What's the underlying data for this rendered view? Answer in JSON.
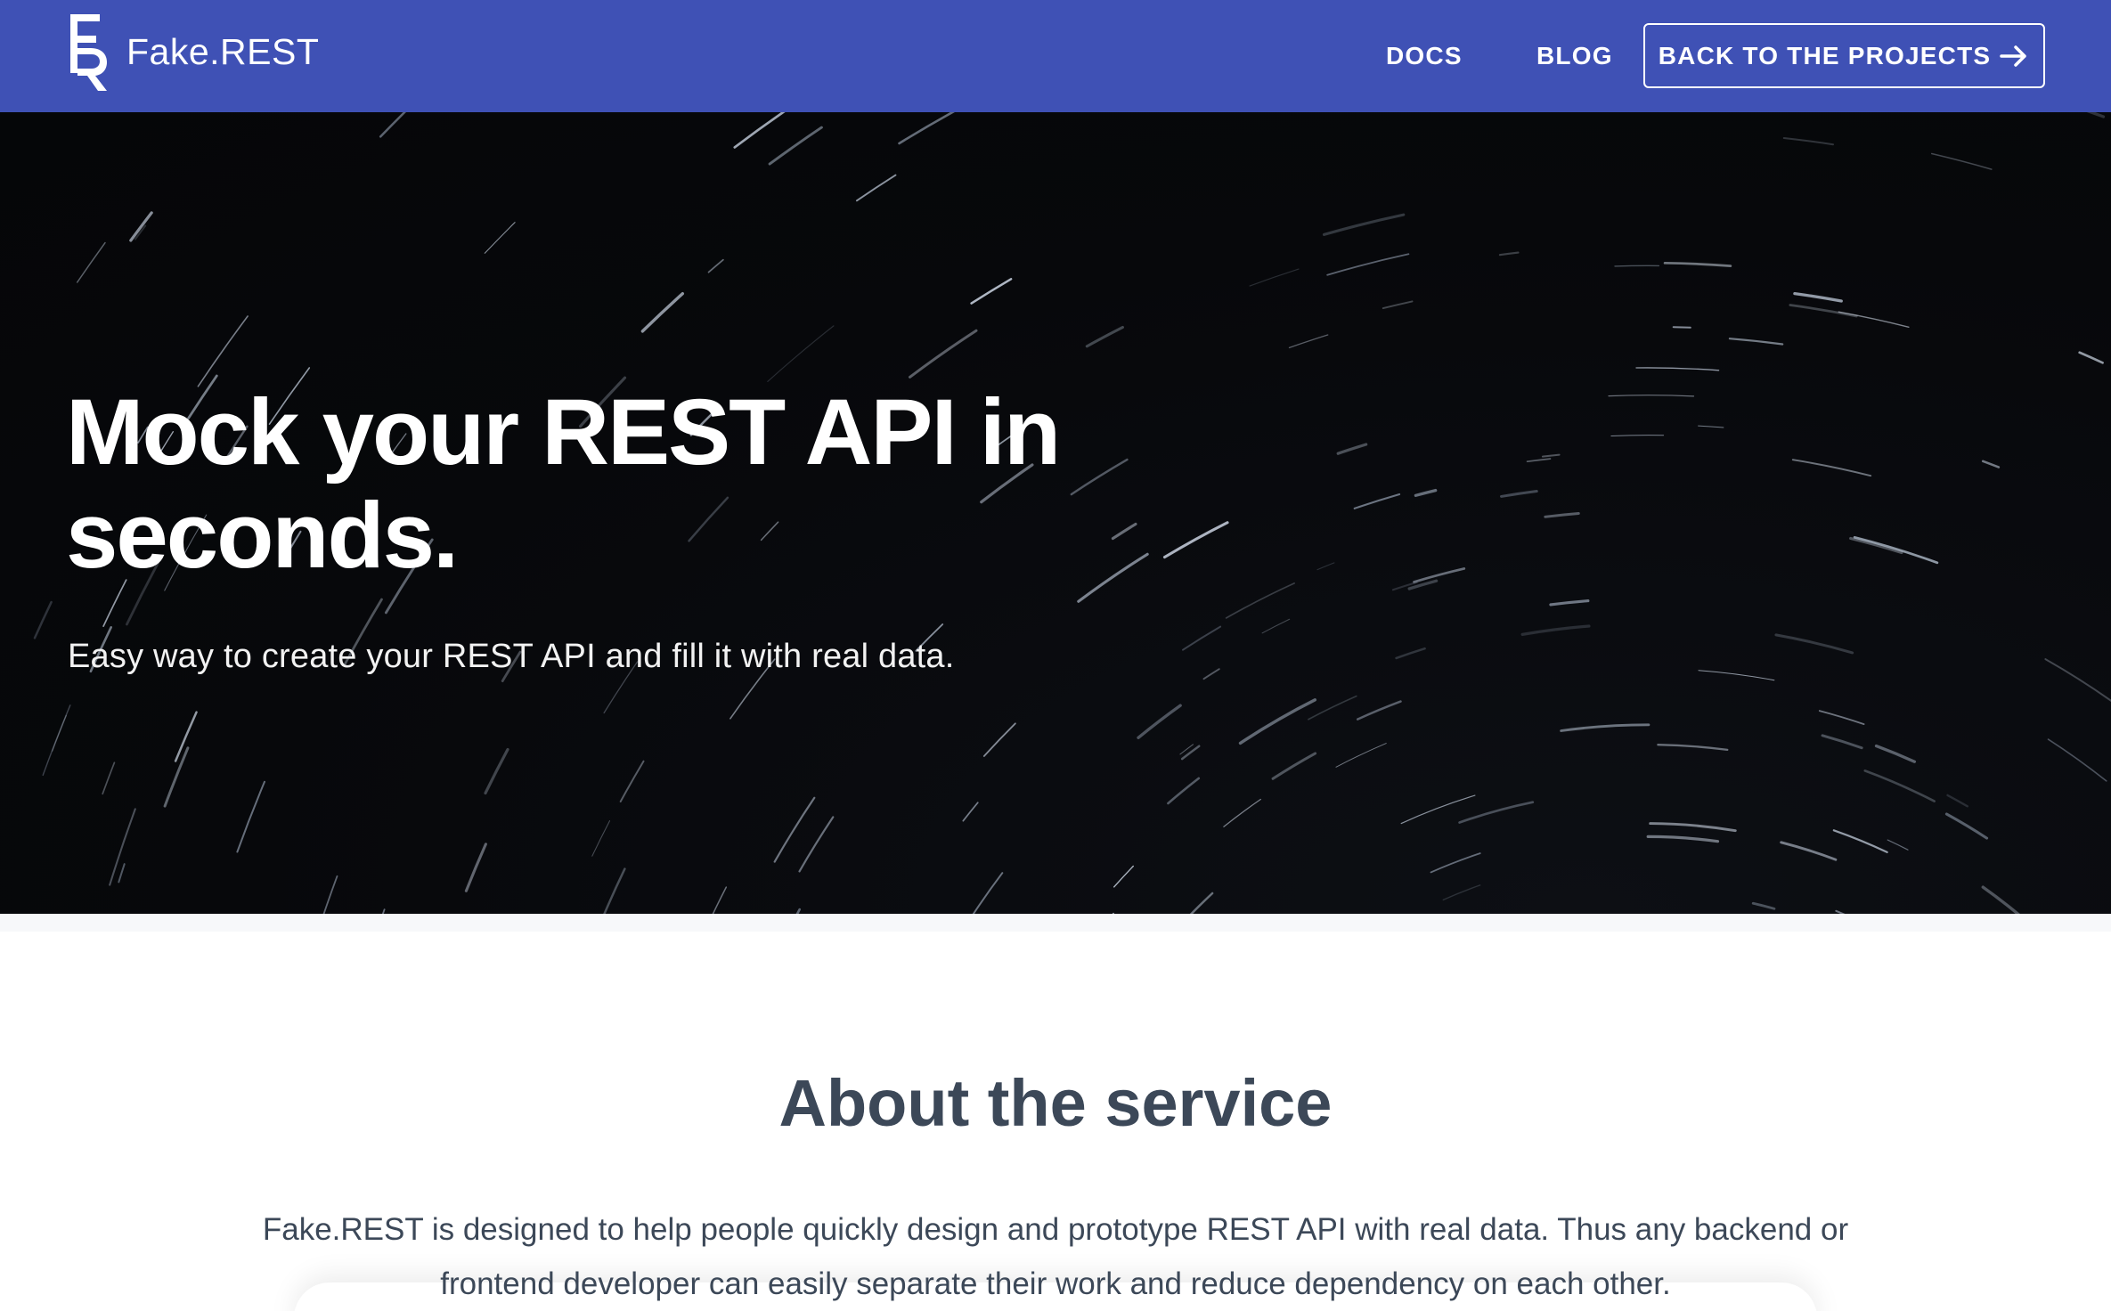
{
  "navbar": {
    "brand_name": "Fake.REST",
    "brand_logo_icon": "fr-monogram-logo",
    "links": {
      "docs": "DOCS",
      "blog": "BLOG",
      "back": "BACK TO THE PROJECTS"
    },
    "back_icon": "arrow-right-icon",
    "color": "#3f51b5"
  },
  "hero": {
    "title_line1": "Mock your REST API in",
    "title_line2": "seconds.",
    "subtitle": "Easy way to create your REST API and fill it with real data."
  },
  "about": {
    "title": "About the service",
    "text": "Fake.REST is designed to help people quickly design and prototype REST API with real data. Thus any backend or frontend developer can easily separate their work and reduce dependency on each other."
  },
  "colors": {
    "accent": "#3f51b5",
    "heading": "#3c4858",
    "hero_bg": "#07080b"
  }
}
